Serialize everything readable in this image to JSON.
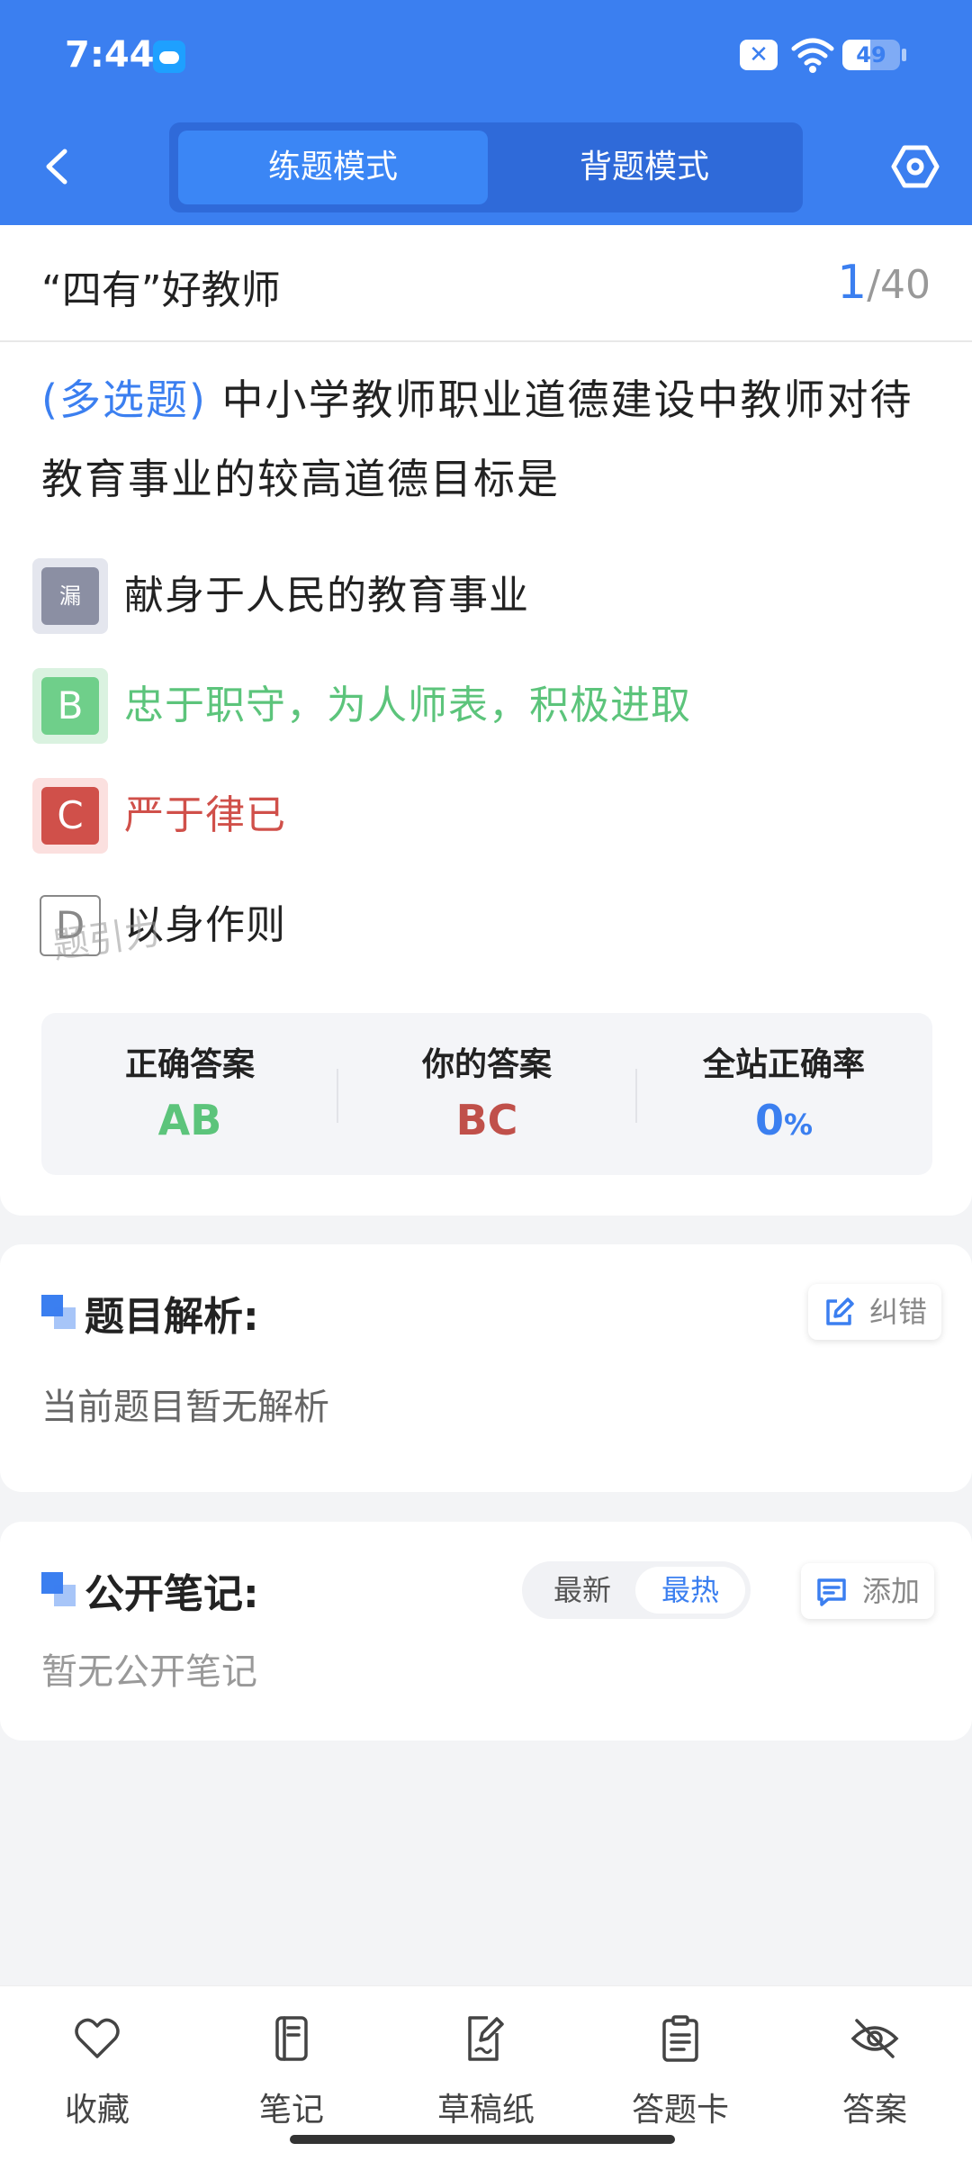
{
  "status_bar": {
    "time": "7:44",
    "battery_level": "49",
    "battery_fraction": 0.49
  },
  "header": {
    "tabs": [
      {
        "label": "练题模式",
        "active": true
      },
      {
        "label": "背题模式",
        "active": false
      }
    ]
  },
  "question": {
    "chapter_title": "“四有”好教师",
    "current": "1",
    "total": "/40",
    "type_label": "(多选题)",
    "text": "中小学教师职业道德建设中教师对待教育事业的较高道德目标是",
    "options": [
      {
        "badge": "漏",
        "text": "献身于人民的教育事业",
        "state": "missed"
      },
      {
        "badge": "B",
        "text": "忠于职守，为人师表，积极进取",
        "state": "correct"
      },
      {
        "badge": "C",
        "text": "严于律已",
        "state": "wrong"
      },
      {
        "badge": "D",
        "text": "以身作则",
        "state": "neutral"
      }
    ]
  },
  "stats": {
    "correct_label": "正确答案",
    "correct_value": "AB",
    "yours_label": "你的答案",
    "yours_value": "BC",
    "rate_label": "全站正确率",
    "rate_value": "0",
    "rate_unit": "%"
  },
  "watermark": "题引力",
  "analysis": {
    "title": "题目解析:",
    "report_label": "纠错",
    "body": "当前题目暂无解析"
  },
  "notes": {
    "title": "公开笔记:",
    "sort_new": "最新",
    "sort_hot": "最热",
    "add_label": "添加",
    "body": "暂无公开笔记"
  },
  "bottom_nav": [
    {
      "label": "收藏",
      "icon": "heart-icon"
    },
    {
      "label": "笔记",
      "icon": "notebook-icon"
    },
    {
      "label": "草稿纸",
      "icon": "draft-paper-icon"
    },
    {
      "label": "答题卡",
      "icon": "answer-sheet-icon"
    },
    {
      "label": "答案",
      "icon": "eye-off-icon"
    }
  ],
  "colors": {
    "primary": "#3b7ff0",
    "correct": "#5cc47b",
    "wrong": "#d0504a"
  }
}
